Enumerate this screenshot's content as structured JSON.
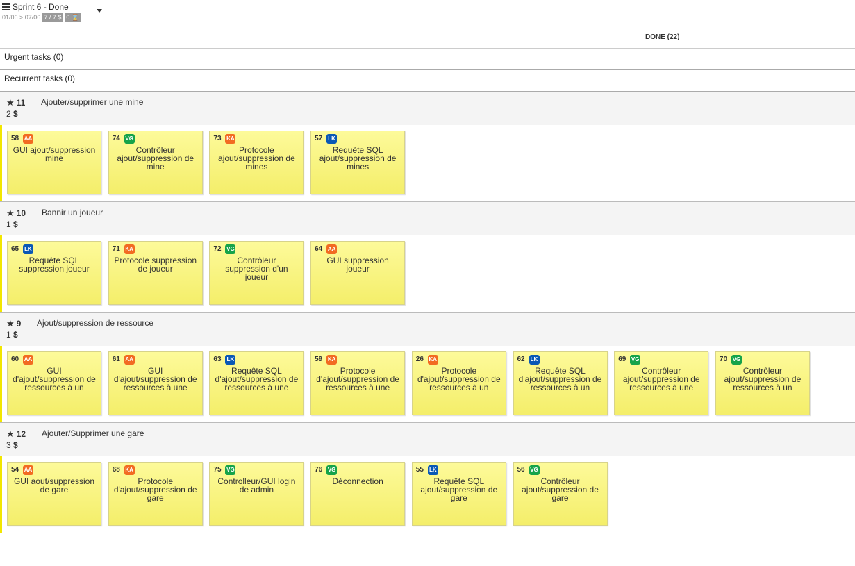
{
  "sprint": {
    "title": "Sprint 6 - Done",
    "dates": "01/06 > 07/06",
    "points_badge": "7 / 7 $",
    "timer_badge": "0 ⌛"
  },
  "column": {
    "header": "DONE (22)"
  },
  "rows": {
    "urgent": "Urgent tasks (0)",
    "recurrent": "Recurrent tasks (0)"
  },
  "colors": {
    "AA": "#f26b22",
    "KA": "#f26b22",
    "VG": "#16a34a",
    "LK": "#0a58b5",
    "story_bar": "#f2e600",
    "card": "#f7f27a"
  },
  "stories": [
    {
      "id": "11",
      "title": "Ajouter/supprimer une mine",
      "points": "2",
      "tasks": [
        {
          "id": "58",
          "user": "AA",
          "text": "GUI ajout/suppression mine"
        },
        {
          "id": "74",
          "user": "VG",
          "text": "Contrôleur ajout/suppression de mine"
        },
        {
          "id": "73",
          "user": "KA",
          "text": "Protocole ajout/suppression de mines"
        },
        {
          "id": "57",
          "user": "LK",
          "text": "Requête SQL ajout/suppression de mines"
        }
      ]
    },
    {
      "id": "10",
      "title": "Bannir un joueur",
      "points": "1",
      "tasks": [
        {
          "id": "65",
          "user": "LK",
          "text": "Requête SQL suppression joueur"
        },
        {
          "id": "71",
          "user": "KA",
          "text": "Protocole suppression de joueur"
        },
        {
          "id": "72",
          "user": "VG",
          "text": "Contrôleur suppression d'un joueur"
        },
        {
          "id": "64",
          "user": "AA",
          "text": "GUI suppression joueur"
        }
      ]
    },
    {
      "id": "9",
      "title": "Ajout/suppression de ressource",
      "points": "1",
      "tasks": [
        {
          "id": "60",
          "user": "AA",
          "text": "GUI d'ajout/suppression de ressources à un"
        },
        {
          "id": "61",
          "user": "AA",
          "text": "GUI d'ajout/suppression de ressources à une"
        },
        {
          "id": "63",
          "user": "LK",
          "text": "Requête SQL d'ajout/suppression de ressources à une"
        },
        {
          "id": "59",
          "user": "KA",
          "text": "Protocole d'ajout/suppression de ressources à une"
        },
        {
          "id": "26",
          "user": "KA",
          "text": "Protocole d'ajout/suppression de ressources à un"
        },
        {
          "id": "62",
          "user": "LK",
          "text": "Requête SQL d'ajout/suppression de ressources à un"
        },
        {
          "id": "69",
          "user": "VG",
          "text": "Contrôleur ajout/suppression de ressources à une"
        },
        {
          "id": "70",
          "user": "VG",
          "text": "Contrôleur ajout/suppression de ressources à un"
        }
      ]
    },
    {
      "id": "12",
      "title": "Ajouter/Supprimer une gare",
      "points": "3",
      "tasks": [
        {
          "id": "54",
          "user": "AA",
          "text": "GUI aout/suppression de gare"
        },
        {
          "id": "68",
          "user": "KA",
          "text": "Protocole d'ajout/suppression de gare"
        },
        {
          "id": "75",
          "user": "VG",
          "text": "Controlleur/GUI login de admin"
        },
        {
          "id": "76",
          "user": "VG",
          "text": "Déconnection"
        },
        {
          "id": "55",
          "user": "LK",
          "text": "Requête SQL ajout/suppression de gare"
        },
        {
          "id": "56",
          "user": "VG",
          "text": "Contrôleur ajout/suppression de gare"
        }
      ]
    }
  ]
}
